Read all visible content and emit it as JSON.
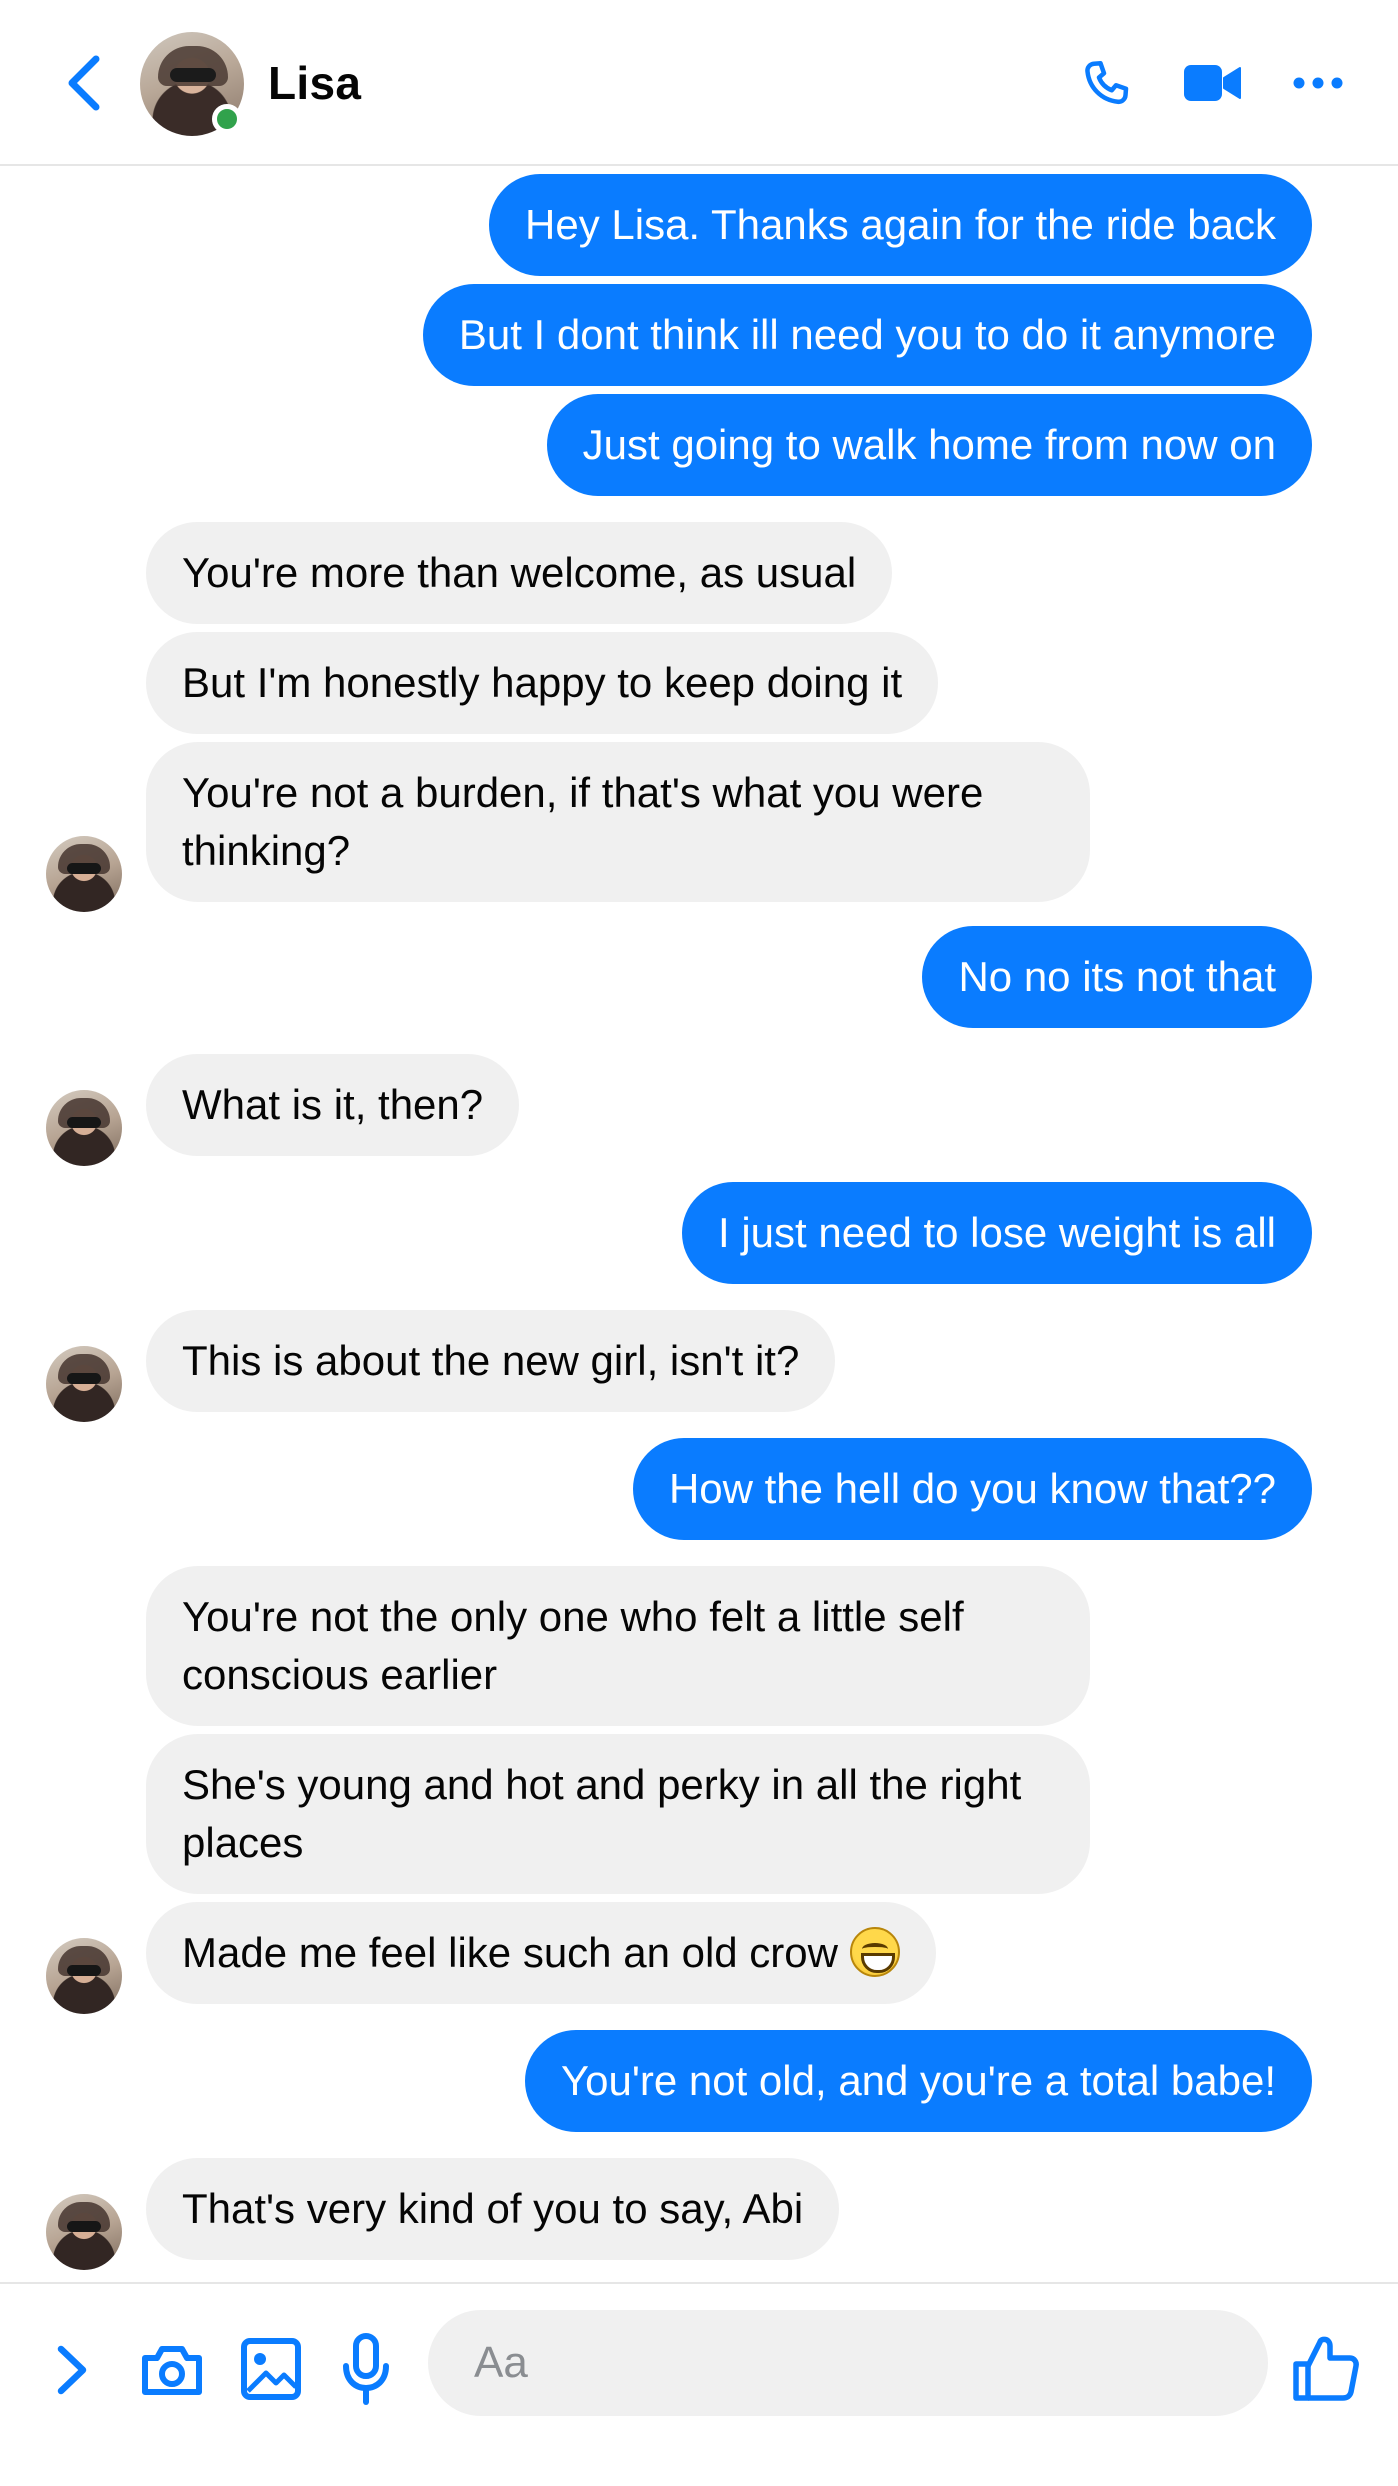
{
  "header": {
    "contact_name": "Lisa",
    "online": true,
    "icons": [
      "back-icon",
      "phone-icon",
      "video-camera-icon",
      "more-icon"
    ]
  },
  "messages": [
    {
      "from": "me",
      "text": "Hey Lisa. Thanks again for the ride back"
    },
    {
      "from": "me",
      "text": "But I dont think ill need you to do it anymore"
    },
    {
      "from": "me",
      "text": "Just going to walk home from now on"
    },
    {
      "from": "them",
      "text": "You're more than welcome, as usual"
    },
    {
      "from": "them",
      "text": "But I'm honestly happy to keep doing it"
    },
    {
      "from": "them",
      "text": "You're not a burden, if that's what you were thinking?"
    },
    {
      "from": "me",
      "text": "No no its not that"
    },
    {
      "from": "them",
      "text": "What is it, then?"
    },
    {
      "from": "me",
      "text": "I just need to lose weight is all"
    },
    {
      "from": "them",
      "text": "This is about the new girl, isn't it?"
    },
    {
      "from": "me",
      "text": "How the hell do you know that??"
    },
    {
      "from": "them",
      "text": "You're not the only one who felt a little self conscious earlier"
    },
    {
      "from": "them",
      "text": "She's young and hot and perky in all the right places"
    },
    {
      "from": "them",
      "text": "Made me feel like such an old crow",
      "emoji": "grinning-face-emoji"
    },
    {
      "from": "me",
      "text": "You're not old, and you're a total babe!"
    },
    {
      "from": "them",
      "text": "That's very kind of you to say, Abi"
    }
  ],
  "composer": {
    "placeholder": "Aa",
    "value": "",
    "icons": [
      "chevron-right-icon",
      "camera-icon",
      "gallery-icon",
      "microphone-icon",
      "thumbs-up-icon"
    ]
  },
  "colors": {
    "accent": "#0a7cff",
    "incoming_bubble": "#f0f0f0",
    "online": "#31a24c"
  }
}
